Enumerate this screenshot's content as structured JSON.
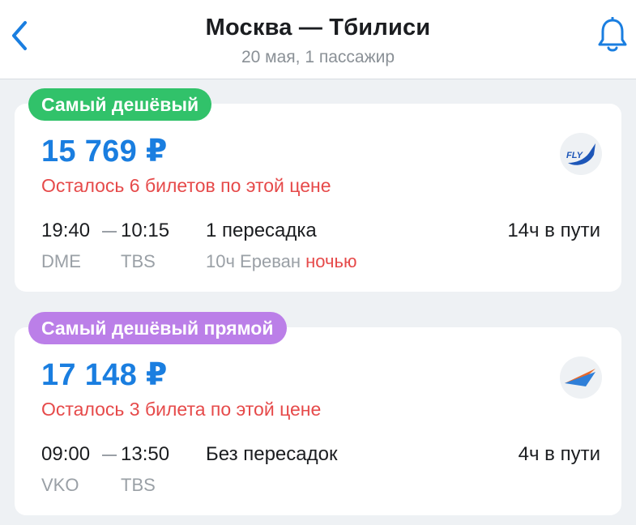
{
  "header": {
    "title": "Москва — Тбилиси",
    "subtitle": "20 мая, 1 пассажир",
    "back_icon": "chevron-left-icon",
    "bell_icon": "bell-icon"
  },
  "colors": {
    "accent": "#1a7ee0",
    "alert": "#e64a4a",
    "badge_cheapest": "#31c26a",
    "badge_direct": "#bb7fe8"
  },
  "offers": [
    {
      "badge": "Самый дешёвый",
      "price": "15 769 ₽",
      "tickets_left": "Осталось 6 билетов по этой цене",
      "depart_time": "19:40",
      "arrive_time": "10:15",
      "depart_code": "DME",
      "arrive_code": "TBS",
      "stops": "1 пересадка",
      "layover": "10ч Ереван",
      "layover_note": "ночью",
      "duration": "14ч в пути",
      "airline_logo": "fly-airline-logo"
    },
    {
      "badge": "Самый дешёвый прямой",
      "price": "17 148 ₽",
      "tickets_left": "Осталось 3 билета по этой цене",
      "depart_time": "09:00",
      "arrive_time": "13:50",
      "depart_code": "VKO",
      "arrive_code": "TBS",
      "stops": "Без пересадок",
      "duration": "4ч в пути",
      "airline_logo": "wings-airline-logo"
    }
  ]
}
